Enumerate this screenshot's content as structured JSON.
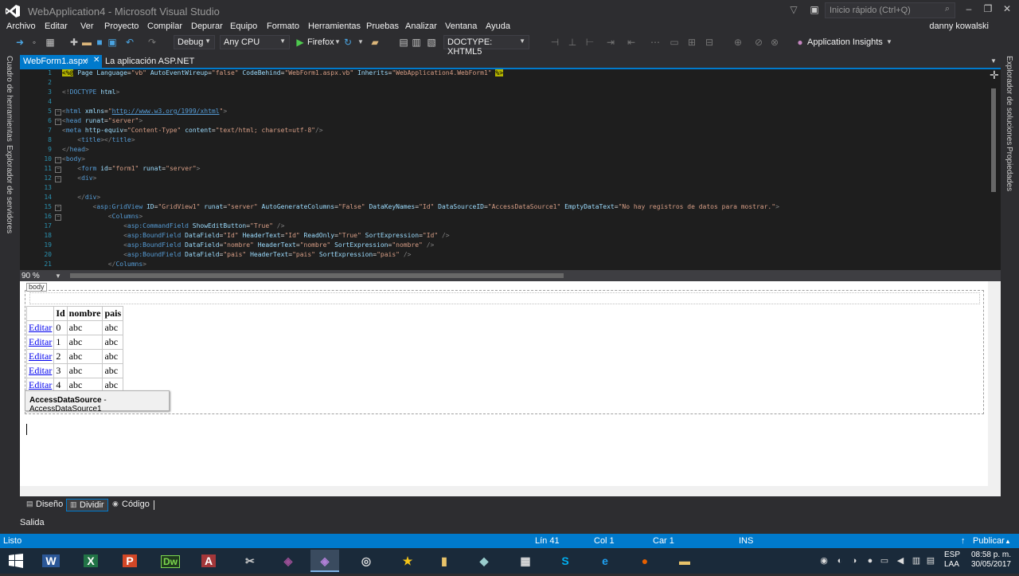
{
  "window": {
    "title": "WebApplication4 - Microsoft Visual Studio",
    "quick_launch_placeholder": "Inicio rápido (Ctrl+Q)",
    "user": "danny kowalski"
  },
  "menu": [
    "Archivo",
    "Editar",
    "Ver",
    "Proyecto",
    "Compilar",
    "Depurar",
    "Equipo",
    "Formato",
    "Herramientas",
    "Pruebas",
    "Analizar",
    "Ventana",
    "Ayuda"
  ],
  "toolbar": {
    "config": "Debug",
    "platform": "Any CPU",
    "browser": "Firefox",
    "doctype": "DOCTYPE: XHTML5",
    "insights": "Application Insights"
  },
  "left_panels": [
    "Cuadro de herramientas",
    "Explorador de servidores"
  ],
  "right_panels": [
    "Explorador de soluciones",
    "Propiedades"
  ],
  "tabs": {
    "active": "WebForm1.aspx",
    "inactive": "La aplicación ASP.NET"
  },
  "code_lines": [
    "1",
    "2",
    "3",
    "4",
    "5",
    "6",
    "7",
    "8",
    "9",
    "10",
    "11",
    "12",
    "13",
    "14",
    "15",
    "16",
    "17",
    "18",
    "19",
    "20",
    "21"
  ],
  "code": {
    "l1": "<%@ Page Language=\"vb\" AutoEventWireup=\"false\" CodeBehind=\"WebForm1.aspx.vb\" Inherits=\"WebApplication4.WebForm1\" %>",
    "l3": "<!DOCTYPE html>",
    "l5_pre": "<html xmlns=\"",
    "l5_url": "http://www.w3.org/1999/xhtml",
    "l5_post": "\">",
    "l6": "<head runat=\"server\">",
    "l7": "<meta http-equiv=\"Content-Type\" content=\"text/html; charset=utf-8\"/>",
    "l8": "    <title></title>",
    "l9": "</head>",
    "l10": "<body>",
    "l11": "    <form id=\"form1\" runat=\"server\">",
    "l12": "    <div>",
    "l14": "    </div>",
    "l15": "        <asp:GridView ID=\"GridView1\" runat=\"server\" AutoGenerateColumns=\"False\" DataKeyNames=\"Id\" DataSourceID=\"AccessDataSource1\" EmptyDataText=\"No hay registros de datos para mostrar.\">",
    "l16": "            <Columns>",
    "l17": "                <asp:CommandField ShowEditButton=\"True\" />",
    "l18": "                <asp:BoundField DataField=\"Id\" HeaderText=\"Id\" ReadOnly=\"True\" SortExpression=\"Id\" />",
    "l19": "                <asp:BoundField DataField=\"nombre\" HeaderText=\"nombre\" SortExpression=\"nombre\" />",
    "l20": "                <asp:BoundField DataField=\"pais\" HeaderText=\"pais\" SortExpression=\"pais\" />",
    "l21": "            </Columns>"
  },
  "zoom": "90 %",
  "design": {
    "body_tag": "body",
    "grid": {
      "headers": [
        "",
        "Id",
        "nombre",
        "pais"
      ],
      "rows": [
        {
          "edit": "Editar",
          "id": "0",
          "nombre": "abc",
          "pais": "abc"
        },
        {
          "edit": "Editar",
          "id": "1",
          "nombre": "abc",
          "pais": "abc"
        },
        {
          "edit": "Editar",
          "id": "2",
          "nombre": "abc",
          "pais": "abc"
        },
        {
          "edit": "Editar",
          "id": "3",
          "nombre": "abc",
          "pais": "abc"
        },
        {
          "edit": "Editar",
          "id": "4",
          "nombre": "abc",
          "pais": "abc"
        }
      ]
    },
    "datasource_type": "AccessDataSource",
    "datasource_name": " - AccessDataSource1"
  },
  "view_tabs": {
    "design": "Diseño",
    "split": "Dividir",
    "code": "Código"
  },
  "output_label": "Salida",
  "status": {
    "ready": "Listo",
    "line": "Lín 41",
    "col": "Col 1",
    "char": "Car 1",
    "mode": "INS",
    "publish": "Publicar"
  },
  "taskbar": {
    "lang1": "ESP",
    "lang2": "LAA",
    "time": "08:58 p. m.",
    "date": "30/05/2017"
  },
  "colors": {
    "accent": "#007acc",
    "editor_bg": "#1e1e1e",
    "chrome_bg": "#2d2d30"
  }
}
